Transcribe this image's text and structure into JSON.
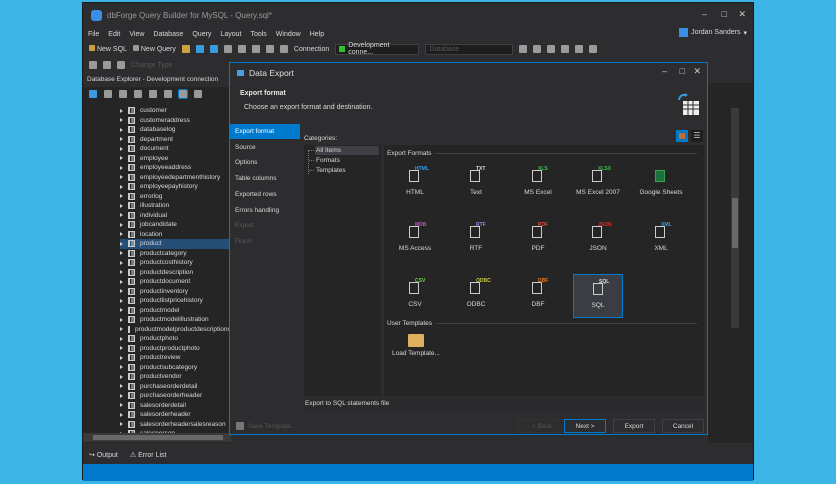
{
  "window": {
    "title": "dbForge Query Builder for MySQL - Query.sql*",
    "user": "Jordan Sanders"
  },
  "menu": [
    "File",
    "Edit",
    "View",
    "Database",
    "Query",
    "Layout",
    "Tools",
    "Window",
    "Help"
  ],
  "toolbar": {
    "new_sql": "New SQL",
    "new_query": "New Query",
    "connection_label": "Connection",
    "connection_value": "Development conne...",
    "database_placeholder": "Database",
    "change_type": "Change Type"
  },
  "db_explorer": {
    "title": "Database Explorer - Development connection",
    "selected": "product",
    "items": [
      "customer",
      "customeraddress",
      "databaselog",
      "department",
      "document",
      "employee",
      "employeeaddress",
      "employeedepartmenthistory",
      "employeepayhistory",
      "errorlog",
      "illustration",
      "individual",
      "jobcandidate",
      "location",
      "product",
      "productcategory",
      "productcosthistory",
      "productdescription",
      "productdocument",
      "productinventory",
      "productlistpricehistory",
      "productmodel",
      "productmodelillustration",
      "productmodelproductdescriptionc...",
      "productphoto",
      "productproductphoto",
      "productreview",
      "productsubcategory",
      "productvendor",
      "purchaseorderdetail",
      "purchaseorderheader",
      "salesorderdetail",
      "salesorderheader",
      "salesorderheadersalesreason",
      "salesperson"
    ]
  },
  "bottom": {
    "output": "Output",
    "error_list": "Error List"
  },
  "dialog": {
    "title": "Data Export",
    "header_title": "Export format",
    "header_subtitle": "Choose an export format and destination.",
    "nav": [
      {
        "label": "Export format",
        "state": "active"
      },
      {
        "label": "Source",
        "state": "enabled"
      },
      {
        "label": "Options",
        "state": "enabled"
      },
      {
        "label": "Table columns",
        "state": "enabled"
      },
      {
        "label": "Exported rows",
        "state": "enabled"
      },
      {
        "label": "Errors handling",
        "state": "enabled"
      },
      {
        "label": "Export",
        "state": "disabled"
      },
      {
        "label": "Finish",
        "state": "disabled"
      }
    ],
    "categories_label": "Categories:",
    "categories": [
      "All Items",
      "Formats",
      "Templates"
    ],
    "export_formats_label": "Export Formats",
    "formats": [
      {
        "label": "HTML",
        "tag": "HTML",
        "color": "#3a9be0"
      },
      {
        "label": "Text",
        "tag": "TXT",
        "color": "#dddddd"
      },
      {
        "label": "MS Excel",
        "tag": "XLS",
        "color": "#3fbf4f"
      },
      {
        "label": "MS Excel 2007",
        "tag": "XLSX",
        "color": "#3fbf4f"
      },
      {
        "label": "Google Sheets",
        "tag": "",
        "color": "#2fa84f"
      },
      {
        "label": "MS Access",
        "tag": "MDB",
        "color": "#b05ab8"
      },
      {
        "label": "RTF",
        "tag": "RTF",
        "color": "#8e8ee8"
      },
      {
        "label": "PDF",
        "tag": "PDF",
        "color": "#e04a3a"
      },
      {
        "label": "JSON",
        "tag": "JSON",
        "color": "#e02a2a"
      },
      {
        "label": "XML",
        "tag": "XML",
        "color": "#3a9be0"
      },
      {
        "label": "CSV",
        "tag": "CSV",
        "color": "#6fcf3f"
      },
      {
        "label": "ODBC",
        "tag": "ODBC",
        "color": "#c8c840"
      },
      {
        "label": "DBF",
        "tag": "DBF",
        "color": "#e87a20"
      },
      {
        "label": "SQL",
        "tag": "SQL",
        "color": "#dddddd"
      }
    ],
    "selected_format": "SQL",
    "user_templates_label": "User Templates",
    "load_template": "Load Template...",
    "status": "Export to SQL statements file",
    "buttons": {
      "save_template": "Save Template...",
      "back": "< Back",
      "next": "Next >",
      "export": "Export",
      "cancel": "Cancel"
    }
  }
}
